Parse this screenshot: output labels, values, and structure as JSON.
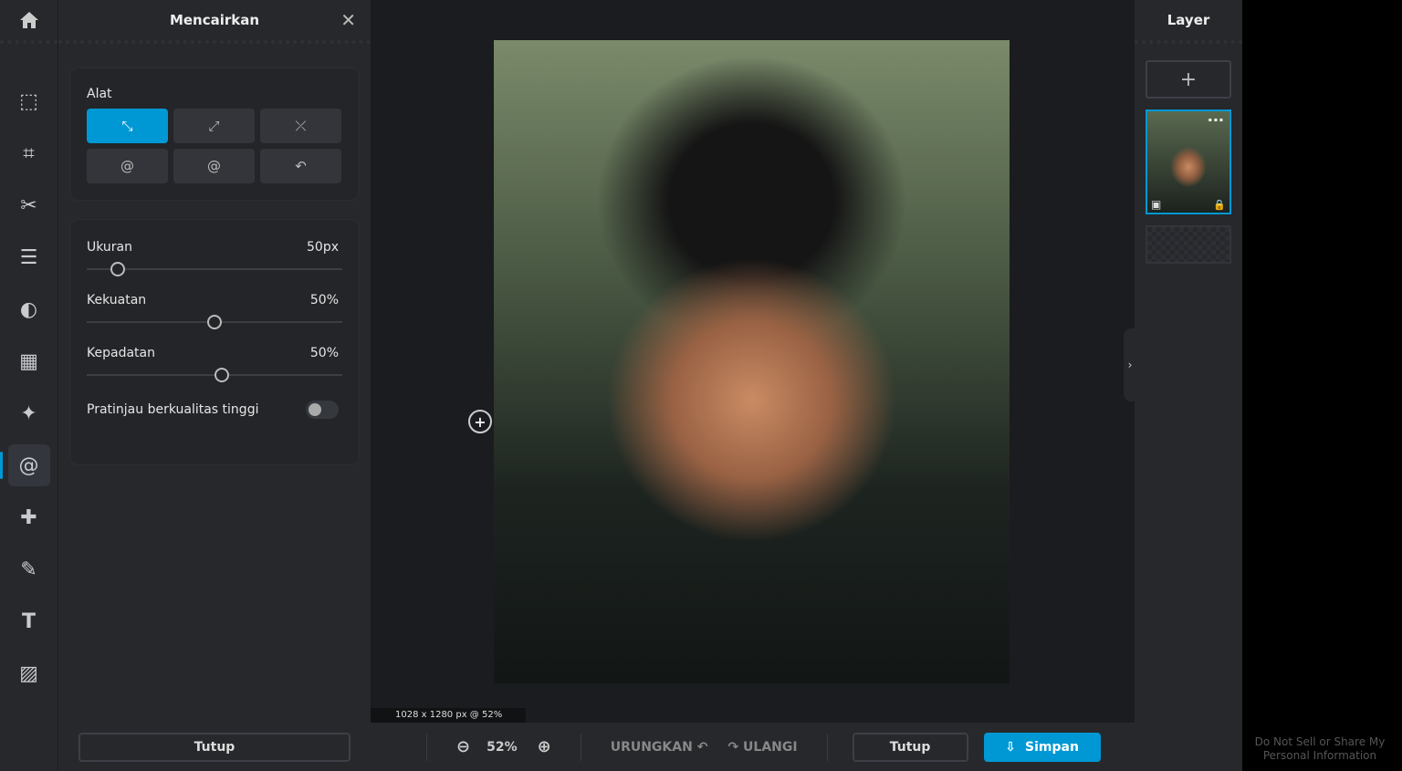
{
  "panel": {
    "title": "Mencairkan",
    "tools_label": "Alat",
    "size_label": "Ukuran",
    "size_value": "50px",
    "size_fraction": 0.12,
    "strength_label": "Kekuatan",
    "strength_value": "50%",
    "strength_fraction": 0.5,
    "density_label": "Kepadatan",
    "density_value": "50%",
    "density_fraction": 0.53,
    "hq_label": "Pratinjau berkualitas tinggi",
    "hq_on": false,
    "close_label": "Tutup"
  },
  "canvas": {
    "size_info": "1028 x 1280 px @ 52%"
  },
  "bottom": {
    "zoom": "52%",
    "undo": "URUNGKAN",
    "redo": "ULANGI",
    "close": "Tutup",
    "save": "Simpan"
  },
  "layers": {
    "title": "Layer",
    "add": "+"
  },
  "footer": {
    "privacy": "Do Not Sell or Share My Personal Information"
  },
  "colors": {
    "accent": "#0098d4"
  }
}
